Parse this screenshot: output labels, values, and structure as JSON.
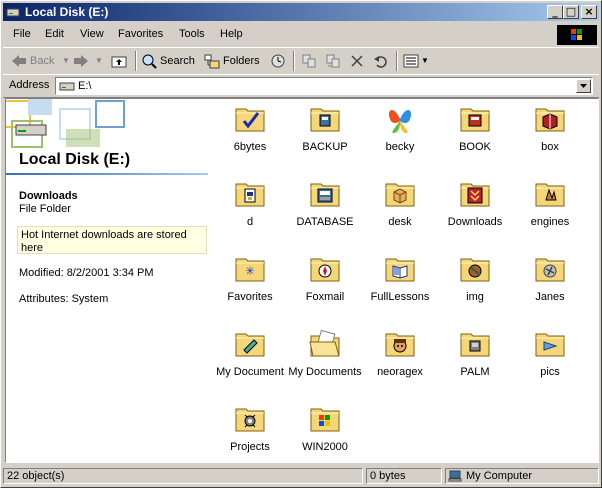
{
  "window": {
    "title": "Local Disk (E:)"
  },
  "menu": [
    "File",
    "Edit",
    "View",
    "Favorites",
    "Tools",
    "Help"
  ],
  "toolbar": {
    "back": "Back",
    "search": "Search",
    "folders": "Folders"
  },
  "address": {
    "label": "Address",
    "value": "E:\\"
  },
  "left_pane": {
    "title": "Local Disk (E:)",
    "selected_name": "Downloads",
    "selected_type": "File Folder",
    "description": "Hot Internet downloads are stored here",
    "modified": "Modified: 8/2/2001 3:34 PM",
    "attributes": "Attributes: System"
  },
  "items": [
    {
      "name": "6bytes",
      "icon": "folder-checkmark-icon"
    },
    {
      "name": "BACKUP",
      "icon": "folder-tape-icon"
    },
    {
      "name": "becky",
      "icon": "butterfly-icon"
    },
    {
      "name": "BOOK",
      "icon": "folder-book-icon"
    },
    {
      "name": "box",
      "icon": "folder-box-icon"
    },
    {
      "name": "d",
      "icon": "folder-doc-icon"
    },
    {
      "name": "DATABASE",
      "icon": "folder-database-icon"
    },
    {
      "name": "desk",
      "icon": "folder-package-icon"
    },
    {
      "name": "Downloads",
      "icon": "folder-downloads-icon"
    },
    {
      "name": "engines",
      "icon": "folder-engine-icon"
    },
    {
      "name": "Favorites",
      "icon": "folder-star-icon"
    },
    {
      "name": "Foxmail",
      "icon": "folder-compass-icon"
    },
    {
      "name": "FullLessons",
      "icon": "folder-openbook-icon"
    },
    {
      "name": "img",
      "icon": "folder-img-icon"
    },
    {
      "name": "Janes",
      "icon": "folder-tools-icon"
    },
    {
      "name": "My Document",
      "icon": "folder-pen-icon"
    },
    {
      "name": "My Documents",
      "icon": "folder-mydocs-icon"
    },
    {
      "name": "neoragex",
      "icon": "folder-face-icon"
    },
    {
      "name": "PALM",
      "icon": "folder-palm-icon"
    },
    {
      "name": "pics",
      "icon": "folder-pics-icon"
    },
    {
      "name": "Projects",
      "icon": "folder-gear-icon"
    },
    {
      "name": "WIN2000",
      "icon": "folder-windows-icon"
    }
  ],
  "status": {
    "objects": "22 object(s)",
    "size": "0 bytes",
    "zone": "My Computer"
  },
  "colors": {
    "titlebar_start": "#0a246a",
    "titlebar_end": "#a6caf0",
    "chrome": "#d4d0c8",
    "folder": "#f5d77a"
  }
}
